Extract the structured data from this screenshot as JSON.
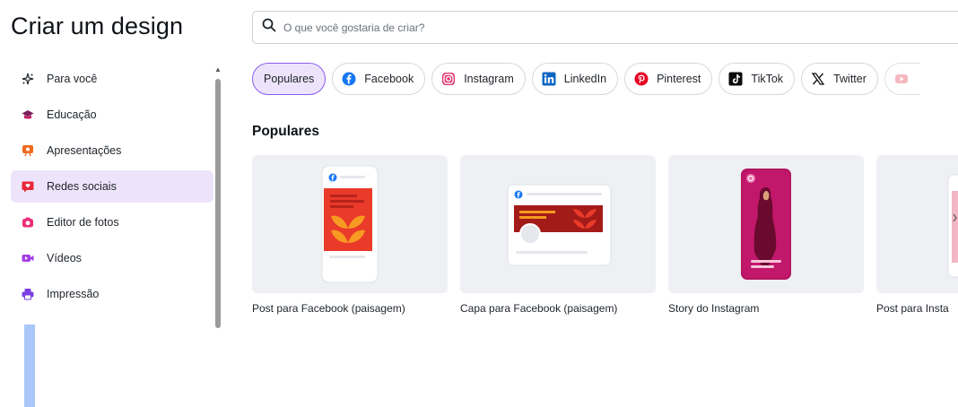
{
  "header": {
    "title": "Criar um design"
  },
  "search": {
    "placeholder": "O que você gostaria de criar?",
    "icon": "search-icon"
  },
  "sidebar": {
    "items": [
      {
        "label": "Para você",
        "icon": "sparkle-icon",
        "active": false
      },
      {
        "label": "Educação",
        "icon": "graduation-cap-icon",
        "active": false
      },
      {
        "label": "Apresentações",
        "icon": "presentation-icon",
        "active": false
      },
      {
        "label": "Redes sociais",
        "icon": "heart-chat-icon",
        "active": true
      },
      {
        "label": "Editor de fotos",
        "icon": "camera-icon",
        "active": false
      },
      {
        "label": "Vídeos",
        "icon": "video-icon",
        "active": false
      },
      {
        "label": "Impressão",
        "icon": "printer-icon",
        "active": false
      }
    ]
  },
  "chips": [
    {
      "label": "Populares",
      "active": true
    },
    {
      "label": "Facebook",
      "icon": "facebook-icon"
    },
    {
      "label": "Instagram",
      "icon": "instagram-icon"
    },
    {
      "label": "LinkedIn",
      "icon": "linkedin-icon"
    },
    {
      "label": "Pinterest",
      "icon": "pinterest-icon"
    },
    {
      "label": "TikTok",
      "icon": "tiktok-icon"
    },
    {
      "label": "Twitter",
      "icon": "x-twitter-icon"
    }
  ],
  "section": {
    "title": "Populares"
  },
  "cards": [
    {
      "label": "Post para Facebook (paisagem)"
    },
    {
      "label": "Capa para Facebook (paisagem)"
    },
    {
      "label": "Story do Instagram"
    },
    {
      "label": "Post para Insta"
    }
  ],
  "colors": {
    "accent": "#8c5cf0",
    "active_bg": "#ede4fc",
    "card_bg": "#eef0f3",
    "facebook_red": "#ea3a2a",
    "instagram_pink": "#c2186b"
  }
}
